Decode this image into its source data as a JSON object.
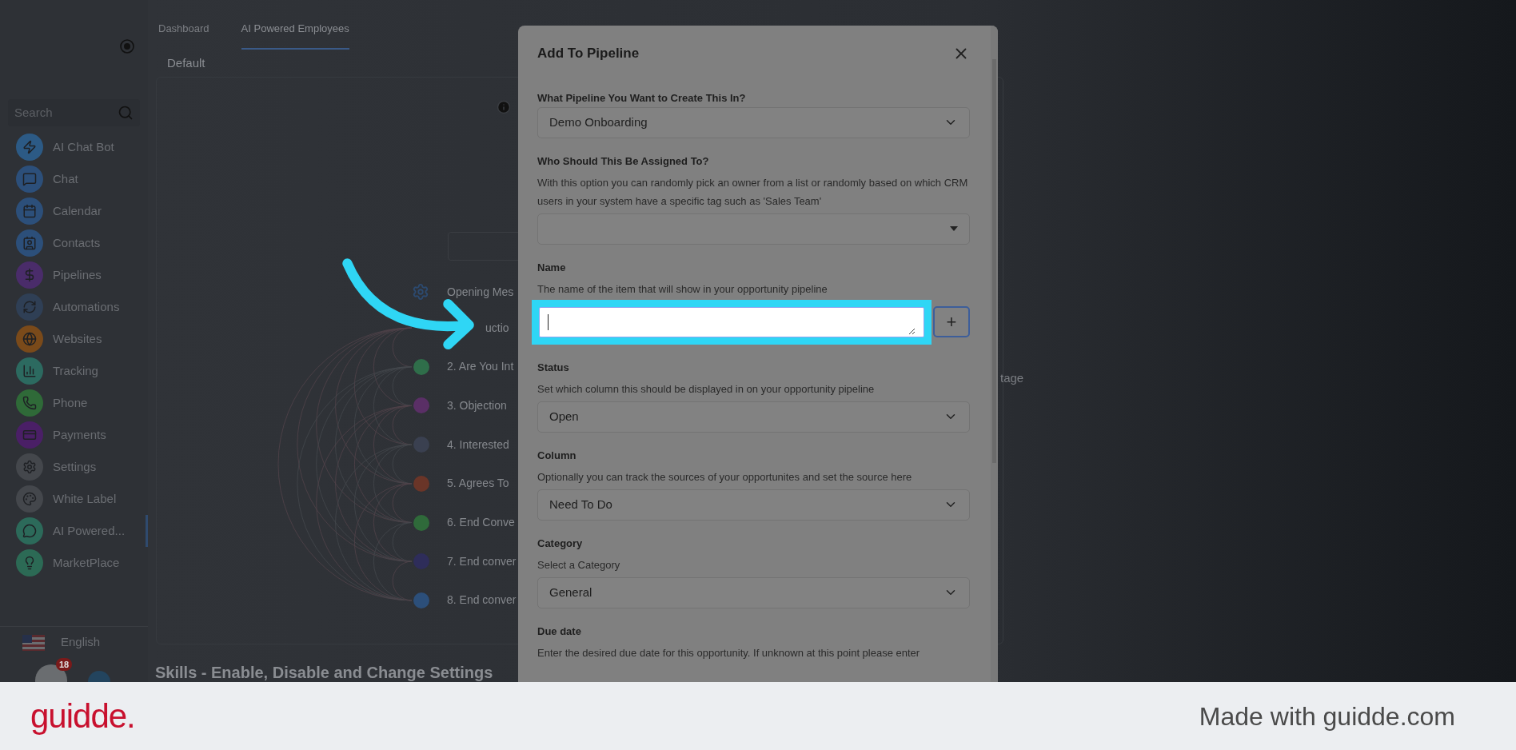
{
  "sidebar": {
    "search": {
      "placeholder": "Search"
    },
    "items": [
      {
        "label": "AI Chat Bot",
        "selected": false,
        "color": "#2c5a85",
        "kind": "bolt"
      },
      {
        "label": "Chat",
        "selected": false,
        "color": "#2c4f7a",
        "kind": "chat"
      },
      {
        "label": "Calendar",
        "selected": false,
        "color": "#2c4f7a",
        "kind": "calendar"
      },
      {
        "label": "Contacts",
        "selected": false,
        "color": "#2c4f7a",
        "kind": "contacts"
      },
      {
        "label": "Pipelines",
        "selected": false,
        "color": "#4a2c6a",
        "kind": "dollar"
      },
      {
        "label": "Automations",
        "selected": false,
        "color": "#2f3f55",
        "kind": "cycle"
      },
      {
        "label": "Websites",
        "selected": false,
        "color": "#7a4a1a",
        "kind": "globe"
      },
      {
        "label": "Tracking",
        "selected": false,
        "color": "#2c6a60",
        "kind": "chart"
      },
      {
        "label": "Phone",
        "selected": false,
        "color": "#2f6a38",
        "kind": "phone"
      },
      {
        "label": "Payments",
        "selected": false,
        "color": "#4a1f66",
        "kind": "card"
      },
      {
        "label": "Settings",
        "selected": false,
        "color": "#44474c",
        "kind": "gear"
      },
      {
        "label": "White Label",
        "selected": false,
        "color": "#44474c",
        "kind": "palette"
      },
      {
        "label": "AI Powered...",
        "selected": true,
        "color": "#2c6a5a",
        "kind": "message"
      },
      {
        "label": "MarketPlace",
        "selected": false,
        "color": "#2c6a55",
        "kind": "bulb"
      }
    ],
    "language": "English",
    "badge": "18"
  },
  "tabs": [
    {
      "label": "Dashboard",
      "selected": false
    },
    {
      "label": "AI Powered Employees",
      "selected": true
    }
  ],
  "sub_tab": "Default",
  "flow": {
    "opening": "Opening Mes",
    "nodes": [
      {
        "label": "uctio"
      },
      {
        "label": "2. Are You Int",
        "color": "#2f6e4a"
      },
      {
        "label": "3. Objection",
        "color": "#5a2f66"
      },
      {
        "label": "4. Interested",
        "color": "#3a4050"
      },
      {
        "label": "5. Agrees To",
        "color": "#6a3528"
      },
      {
        "label": "6. End Conve",
        "color": "#2f6a3a"
      },
      {
        "label": "7. End conver",
        "color": "#2e2d5a"
      },
      {
        "label": "8. End conver",
        "color": "#2c4f7a"
      }
    ]
  },
  "skills_heading": "Skills - Enable, Disable and Change Settings",
  "side_fragment": "tage",
  "modal": {
    "title": "Add To Pipeline",
    "fields": [
      {
        "kind": "dropdown",
        "label": "What Pipeline You Want to Create This In?",
        "value": "Demo Onboarding"
      },
      {
        "kind": "combo",
        "label": "Who Should This Be Assigned To?",
        "description": "With this option you can randomly pick an owner from a list or randomly based on which CRM users in your system have a specific tag such as 'Sales Team'"
      },
      {
        "kind": "textarea",
        "label": "Name",
        "description": "The name of the item that will show in your opportunity pipeline",
        "highlighted": true,
        "button": "+"
      },
      {
        "kind": "dropdown",
        "label": "Status",
        "description": "Set which column this should be displayed in on your opportunity pipeline",
        "value": "Open"
      },
      {
        "kind": "dropdown",
        "label": "Column",
        "description": "Optionally you can track the sources of your opportunites and set the source here",
        "value": "Need To Do"
      },
      {
        "kind": "dropdown",
        "label": "Category",
        "description": "Select a Category",
        "value": "General"
      },
      {
        "kind": "text",
        "label": "Due date",
        "description": "Enter the desired due date for this opportunity. If unknown at this point please enter"
      }
    ]
  },
  "banner": {
    "logo": "guidde.",
    "text": "Made with guidde.com"
  }
}
